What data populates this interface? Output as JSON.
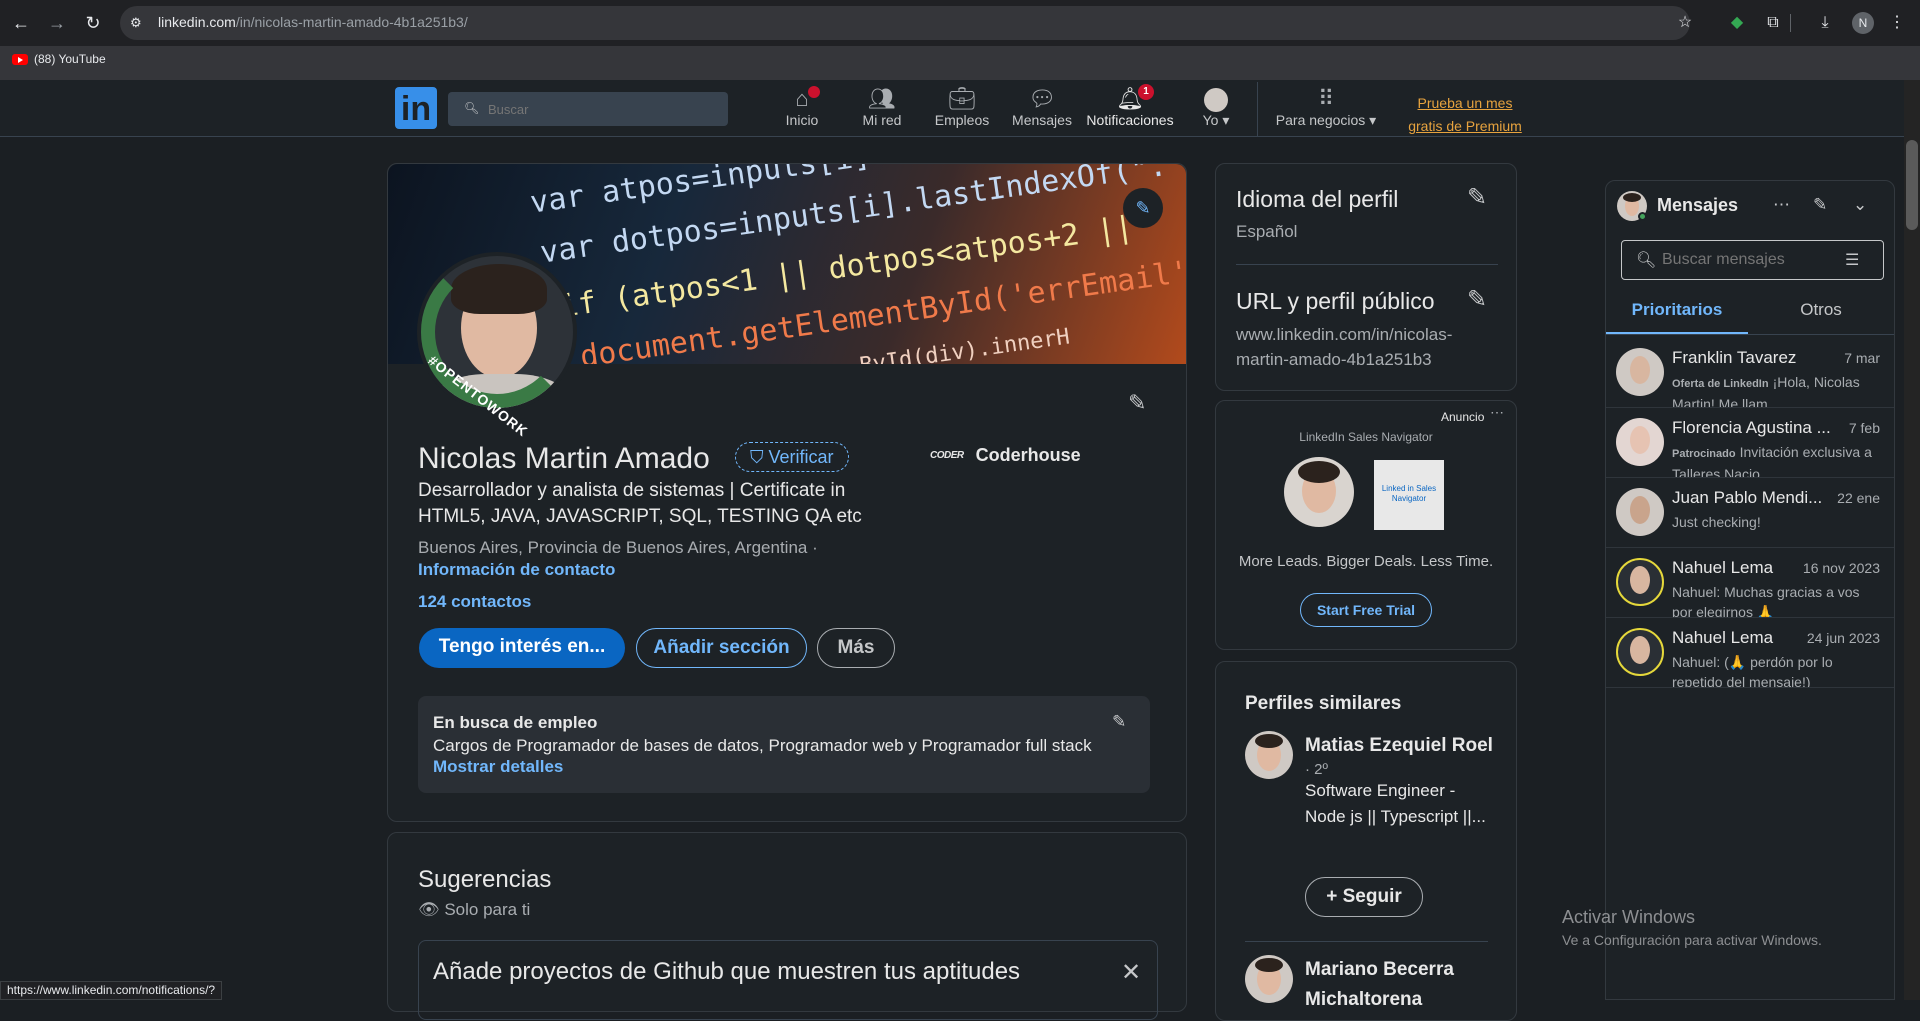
{
  "browser": {
    "url_host": "linkedin.com",
    "url_path": "/in/nicolas-martin-amado-4b1a251b3/",
    "profile_initial": "N",
    "bookmarks": [
      {
        "label": "(88) YouTube"
      }
    ],
    "status_url": "https://www.linkedin.com/notifications/?"
  },
  "header": {
    "search_placeholder": "Buscar",
    "nav": [
      {
        "label": "Inicio",
        "icon": "home-icon",
        "badge": ""
      },
      {
        "label": "Mi red",
        "icon": "network-icon",
        "badge": ""
      },
      {
        "label": "Empleos",
        "icon": "jobs-icon",
        "badge": ""
      },
      {
        "label": "Mensajes",
        "icon": "messaging-icon",
        "badge": ""
      },
      {
        "label": "Notificaciones",
        "icon": "bell-icon",
        "badge": "1"
      },
      {
        "label": "Yo",
        "icon": "me-avatar",
        "badge": ""
      },
      {
        "label": "Para negocios",
        "icon": "grid-icon",
        "badge": ""
      }
    ],
    "premium_line1": "Prueba un mes",
    "premium_line2": "gratis de Premium"
  },
  "profile": {
    "name": "Nicolas Martin Amado",
    "verify_label": "Verificar",
    "headline": "Desarrollador y analista de sistemas | Certificate in HTML5, JAVA, JAVASCRIPT, SQL, TESTING QA etc",
    "location": "Buenos Aires, Provincia de Buenos Aires, Argentina ·",
    "contact_info": "Información de contacto",
    "connections": "124 contactos",
    "company_logo_text": "CODER",
    "company": "Coderhouse",
    "open_to_work_badge": "#OPENTOWORK",
    "buttons": {
      "open_to": "Tengo interés en...",
      "add_section": "Añadir sección",
      "more": "Más"
    },
    "open_to_work": {
      "title": "En busca de empleo",
      "description": "Cargos de Programador de bases de datos, Programador web y Programador full stack",
      "link": "Mostrar detalles"
    },
    "banner_code": [
      "var atpos=inputs[i].indexOf(",
      "var dotpos=inputs[i].lastIndexOf(\".\");",
      "if (atpos<1 || dotpos<atpos+2 ||",
      "document.getElementById('errEmail')",
      "ById(div).innerH"
    ]
  },
  "suggestions": {
    "title": "Sugerencias",
    "private_label": "Solo para ti",
    "item": "Añade proyectos de Github que muestren tus aptitudes"
  },
  "sidebar": {
    "language_title": "Idioma del perfil",
    "language_value": "Español",
    "url_title": "URL y perfil público",
    "url_value": "www.linkedin.com/in/nicolas-martin-amado-4b1a251b3"
  },
  "ad": {
    "label": "Anuncio",
    "brand": "LinkedIn Sales Navigator",
    "logo_text": "Linked in Sales Navigator",
    "tagline": "More Leads. Bigger Deals. Less Time.",
    "cta": "Start Free Trial"
  },
  "similar": {
    "title": "Perfiles similares",
    "people": [
      {
        "name": "Matias Ezequiel Roel",
        "degree": "· 2º",
        "headline": "Software Engineer - Node js || Typescript ||...",
        "follow": "+ Seguir"
      },
      {
        "name": "Mariano Becerra Michaltorena",
        "degree": "",
        "headline": "",
        "follow": ""
      }
    ]
  },
  "messaging": {
    "title": "Mensajes",
    "search_placeholder": "Buscar mensajes",
    "tabs": [
      "Prioritarios",
      "Otros"
    ],
    "conversations": [
      {
        "name": "Franklin Tavarez",
        "date": "7 mar",
        "tag": "Oferta de LinkedIn",
        "preview": "¡Hola, Nicolas Martin! Me llam..."
      },
      {
        "name": "Florencia Agustina ...",
        "date": "7 feb",
        "tag": "Patrocinado",
        "preview": "Invitación exclusiva a Talleres Nacio..."
      },
      {
        "name": "Juan Pablo Mendi...",
        "date": "22 ene",
        "tag": "",
        "preview": "Just checking!"
      },
      {
        "name": "Nahuel Lema",
        "date": "16 nov 2023",
        "tag": "",
        "preview": "Nahuel: Muchas gracias a vos por elegirnos 🙏"
      },
      {
        "name": "Nahuel Lema",
        "date": "24 jun 2023",
        "tag": "",
        "preview": "Nahuel: (🙏 perdón por lo repetido del mensaje!)"
      }
    ]
  },
  "windows": {
    "title": "Activar Windows",
    "subtitle": "Ve a Configuración para activar Windows."
  }
}
